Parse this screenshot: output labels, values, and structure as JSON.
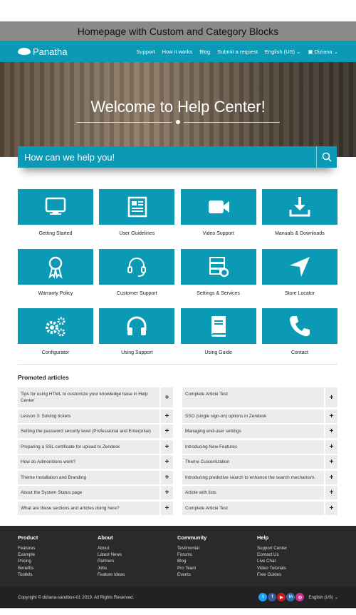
{
  "caption": "Homepage with Custom and Category Blocks",
  "nav": {
    "logo": "Panatha",
    "items": [
      "Support",
      "How it works",
      "Blog",
      "Submit a request"
    ],
    "language": "English (US)",
    "user": "Diziana"
  },
  "hero": {
    "title": "Welcome to Help Center!",
    "search_placeholder": "How can we help you!"
  },
  "categories": [
    {
      "label": "Getting Started",
      "icon": "monitor-icon"
    },
    {
      "label": "User Guidelines",
      "icon": "newspaper-icon"
    },
    {
      "label": "Video Support",
      "icon": "video-camera-icon"
    },
    {
      "label": "Manuals & Downloads",
      "icon": "download-icon"
    },
    {
      "label": "Warranty Policy",
      "icon": "award-ribbon-icon"
    },
    {
      "label": "Customer Support",
      "icon": "headset-icon"
    },
    {
      "label": "Settings & Services",
      "icon": "server-settings-icon"
    },
    {
      "label": "Store Locator",
      "icon": "location-arrow-icon"
    },
    {
      "label": "Configurator",
      "icon": "gears-icon"
    },
    {
      "label": "Using Support",
      "icon": "headphones-icon"
    },
    {
      "label": "Using Guide",
      "icon": "book-icon"
    },
    {
      "label": "Contact",
      "icon": "phone-icon"
    }
  ],
  "promoted": {
    "title": "Promoted articles",
    "articles": [
      "Tips for using HTML to customize your knowledge base in Help Center",
      "Complete Article Test",
      "Lesson 3: Solving tickets",
      "SSO (single sign-on) options in Zendesk",
      "Setting the password security level (Professional and Enterprise)",
      "Managing end-user settings",
      "Preparing a SSL certificate for upload to Zendesk",
      "Introducing New Features",
      "How do Admonitions work?",
      "Theme Customization",
      "Theme Installation and Branding",
      "Introducing predictive search to enhance the search mechanism.",
      "About the System Status page",
      "Article with lists",
      "What are these sections and articles doing here?",
      "Complete Article Test"
    ],
    "expand_symbol": "+"
  },
  "footer": {
    "columns": [
      {
        "title": "Product",
        "links": [
          "Features",
          "Example",
          "Pricing",
          "Benefits",
          "Toolkits"
        ]
      },
      {
        "title": "About",
        "links": [
          "About",
          "Latest News",
          "Partners",
          "Jobs",
          "Feature Ideas"
        ]
      },
      {
        "title": "Community",
        "links": [
          "Testimonial",
          "Forums",
          "Blog",
          "Pro Team",
          "Events"
        ]
      },
      {
        "title": "Help",
        "links": [
          "Support Center",
          "Contact Us",
          "Live Chat",
          "Video Tutorials",
          "Free Guides"
        ]
      }
    ],
    "copyright": "Copyright © diziana-sandbox-01 2019. All Rights Reserved.",
    "language": "English (US)",
    "social": [
      {
        "name": "twitter",
        "color": "#1da1f2",
        "glyph": "t"
      },
      {
        "name": "facebook",
        "color": "#3b5998",
        "glyph": "f"
      },
      {
        "name": "youtube",
        "color": "#cc1a1a",
        "glyph": "▶"
      },
      {
        "name": "linkedin",
        "color": "#2a6fb0",
        "glyph": "in"
      },
      {
        "name": "instagram",
        "color": "#c13584",
        "glyph": "◎"
      }
    ]
  },
  "colors": {
    "brand": "#0a9ab5",
    "footer": "#2a2a2a"
  }
}
